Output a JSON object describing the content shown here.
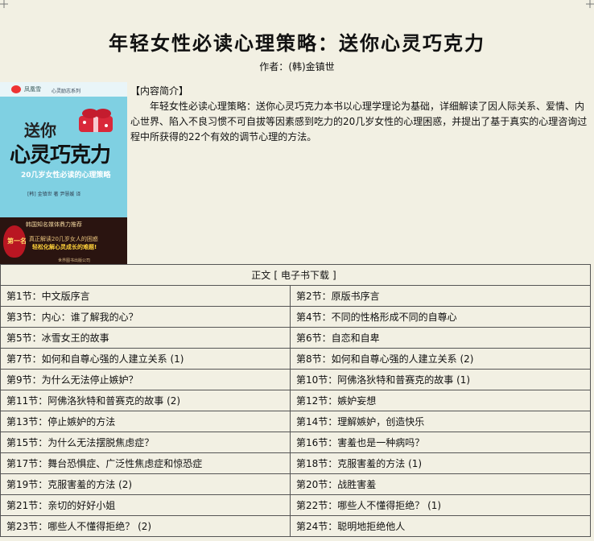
{
  "title": "年轻女性必读心理策略：送你心灵巧克力",
  "author_label": "作者：",
  "author_name": "(韩)金镇世",
  "cover": {
    "alt": "送你心灵巧克力",
    "publisher": "凤凰雪",
    "series": "心灵励志系列",
    "title_line1": "送你",
    "title_line2": "心灵巧克力",
    "subtitle": "20几岁女性必读的心理策略",
    "authors_small": "[韩] 金镇世 著    尹慧媛 译",
    "band_line1": "韩国知名媒体鼎力推荐",
    "badge": "第一名",
    "band_line2": "真正解读20几岁女人的困惑",
    "band_line3": "轻松化解心灵成长的难题!",
    "press": "世界图书出版公司",
    "colors": {
      "sky": "#7fd0e2",
      "dark_band": "#2a1410",
      "badge": "#b91622",
      "gift_red": "#d9283a"
    }
  },
  "intro": {
    "heading": "【内容简介】",
    "text": "年轻女性必读心理策略：送你心灵巧克力本书以心理学理论为基础，详细解读了因人际关系、爱情、内心世界、陷入不良习惯不可自拔等因素感到吃力的20几岁女性的心理困惑，并提出了基于真实的心理咨询过程中所获得的22个有效的调节心理的方法。"
  },
  "toc": {
    "header_main": "正文",
    "header_bracket_open": "[",
    "header_link": "电子书下载",
    "header_bracket_close": "]",
    "rows": [
      [
        "第1节：中文版序言",
        "第2节：原版书序言"
      ],
      [
        "第3节：内心：谁了解我的心？",
        "第4节：不同的性格形成不同的自尊心"
      ],
      [
        "第5节：冰雪女王的故事",
        "第6节：自恋和自卑"
      ],
      [
        "第7节：如何和自尊心强的人建立关系 (1)",
        "第8节：如何和自尊心强的人建立关系 (2)"
      ],
      [
        "第9节：为什么无法停止嫉妒？",
        "第10节：阿佛洛狄特和普赛克的故事 (1)"
      ],
      [
        "第11节：阿佛洛狄特和普赛克的故事 (2)",
        "第12节：嫉妒妄想"
      ],
      [
        "第13节：停止嫉妒的方法",
        "第14节：理解嫉妒，创造快乐"
      ],
      [
        "第15节：为什么无法摆脱焦虑症？",
        "第16节：害羞也是一种病吗？"
      ],
      [
        "第17节：舞台恐惧症、广泛性焦虑症和惊恐症",
        "第18节：克服害羞的方法 (1)"
      ],
      [
        "第19节：克服害羞的方法 (2)",
        "第20节：战胜害羞"
      ],
      [
        "第21节：亲切的好好小姐",
        "第22节：哪些人不懂得拒绝？ (1)"
      ],
      [
        "第23节：哪些人不懂得拒绝？ (2)",
        "第24节：聪明地拒绝他人"
      ]
    ]
  }
}
